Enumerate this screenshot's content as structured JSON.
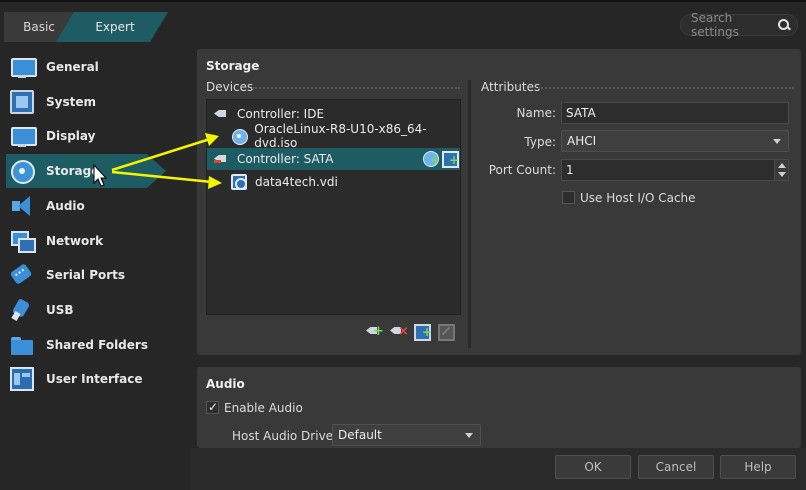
{
  "mode_tabs": {
    "basic": "Basic",
    "expert": "Expert"
  },
  "search": {
    "placeholder": "Search settings"
  },
  "sidebar": {
    "items": [
      {
        "label": "General",
        "icon": "monitor-icon"
      },
      {
        "label": "System",
        "icon": "chip-icon"
      },
      {
        "label": "Display",
        "icon": "display-icon"
      },
      {
        "label": "Storage",
        "icon": "disc-icon",
        "active": true
      },
      {
        "label": "Audio",
        "icon": "speaker-icon"
      },
      {
        "label": "Network",
        "icon": "network-icon"
      },
      {
        "label": "Serial Ports",
        "icon": "serial-port-icon"
      },
      {
        "label": "USB",
        "icon": "usb-icon"
      },
      {
        "label": "Shared Folders",
        "icon": "folder-icon"
      },
      {
        "label": "User Interface",
        "icon": "user-interface-icon"
      }
    ]
  },
  "storage": {
    "title": "Storage",
    "devices_label": "Devices",
    "attributes_label": "Attributes",
    "tree": [
      {
        "label": "Controller: IDE",
        "type": "controller"
      },
      {
        "label": "OracleLinux-R8-U10-x86_64-dvd.iso",
        "type": "optical"
      },
      {
        "label": "Controller: SATA",
        "type": "controller",
        "selected": true
      },
      {
        "label": "data4tech.vdi",
        "type": "disk"
      }
    ],
    "attributes": {
      "name_label": "Name:",
      "name_value": "SATA",
      "type_label": "Type:",
      "type_value": "AHCI",
      "port_count_label": "Port Count:",
      "port_count_value": "1",
      "host_io_cache_label": "Use Host I/O Cache",
      "host_io_cache_checked": false
    }
  },
  "audio": {
    "title": "Audio",
    "enable_label": "Enable Audio",
    "enable_checked": true,
    "driver_label": "Host Audio Driver:",
    "driver_value": "Default"
  },
  "footer": {
    "ok": "OK",
    "cancel": "Cancel",
    "help": "Help"
  },
  "colors": {
    "accent": "#1e5c63",
    "annotation_arrow": "#f5f500",
    "background": "#262626",
    "panel": "#393939"
  }
}
